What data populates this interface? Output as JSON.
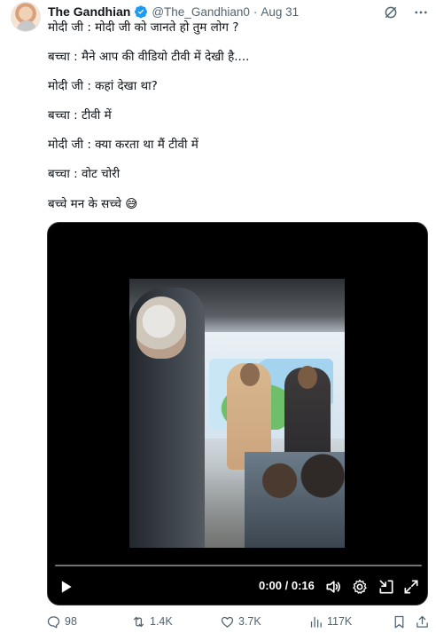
{
  "post": {
    "display_name": "The Gandhian",
    "handle": "@The_Gandhian0",
    "separator": "·",
    "date": "Aug 31",
    "lines": [
      "मोदी जी :  मोदी जी को जानते हो तुम लोग ?",
      "बच्चा : मैने आप की वीडियो टीवी में देखी है....",
      "मोदी जी : कहां देखा था?",
      "बच्चा : टीवी में",
      "मोदी जी : क्या करता था मैं टीवी में",
      "बच्चा : वोट चोरी",
      "बच्चे मन के सच्चे 😅"
    ]
  },
  "video": {
    "time": "0:00 / 0:16",
    "progress": 0
  },
  "actions": {
    "replies": "98",
    "reposts": "1.4K",
    "likes": "3.7K",
    "views": "117K"
  },
  "colors": {
    "verified": "#1d9bf0",
    "muted_text": "#536471",
    "video_background": "#000000"
  },
  "icons": [
    "grok-icon",
    "more-icon",
    "verified-icon",
    "play-icon",
    "volume-icon",
    "settings-icon",
    "minimize-icon",
    "fullscreen-icon",
    "reply-icon",
    "repost-icon",
    "like-icon",
    "views-icon",
    "bookmark-icon",
    "share-icon"
  ]
}
